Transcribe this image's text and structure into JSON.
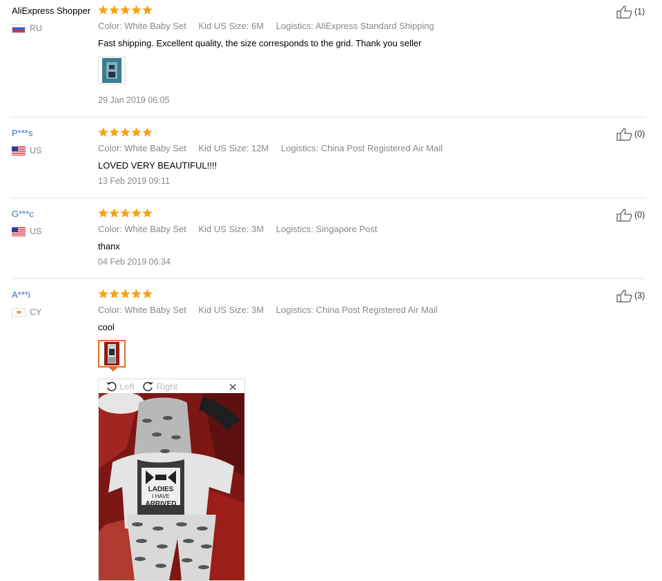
{
  "reviews": [
    {
      "user": "AliExpress Shopper",
      "country": "RU",
      "color": "Color: White Baby Set",
      "size": "Kid US Size: 6M",
      "logistics": "Logistics: AliExpress Standard Shipping",
      "text": "Fast shipping. Excellent quality, the size corresponds to the grid. Thank you seller",
      "date": "29 Jan 2019 06:05",
      "likes": "(1)",
      "rating": 5
    },
    {
      "user": "P***s",
      "country": "US",
      "color": "Color: White Baby Set",
      "size": "Kid US Size: 12M",
      "logistics": "Logistics: China Post Registered Air Mail",
      "text": "LOVED VERY BEAUTIFUL!!!!",
      "date": "13 Feb 2019 09:11",
      "likes": "(0)",
      "rating": 5
    },
    {
      "user": "G***c",
      "country": "US",
      "color": "Color: White Baby Set",
      "size": "Kid US Size: 3M",
      "logistics": "Logistics: Singapore Post",
      "text": "thanx",
      "date": "04 Feb 2019 06:34",
      "likes": "(0)",
      "rating": 5
    },
    {
      "user": "A***i",
      "country": "CY",
      "color": "Color: White Baby Set",
      "size": "Kid US Size: 3M",
      "logistics": "Logistics: China Post Registered Air Mail",
      "text": "cool",
      "likes": "(3)",
      "rating": 5
    }
  ],
  "viewer": {
    "left_label": "Left",
    "right_label": "Right",
    "photo_text": [
      "LADIES",
      "I HAVE",
      "ARRIVED"
    ]
  },
  "colors": {
    "star": "#f8a218",
    "link": "#2e6ec7",
    "active_thumb": "#e56c1b"
  }
}
